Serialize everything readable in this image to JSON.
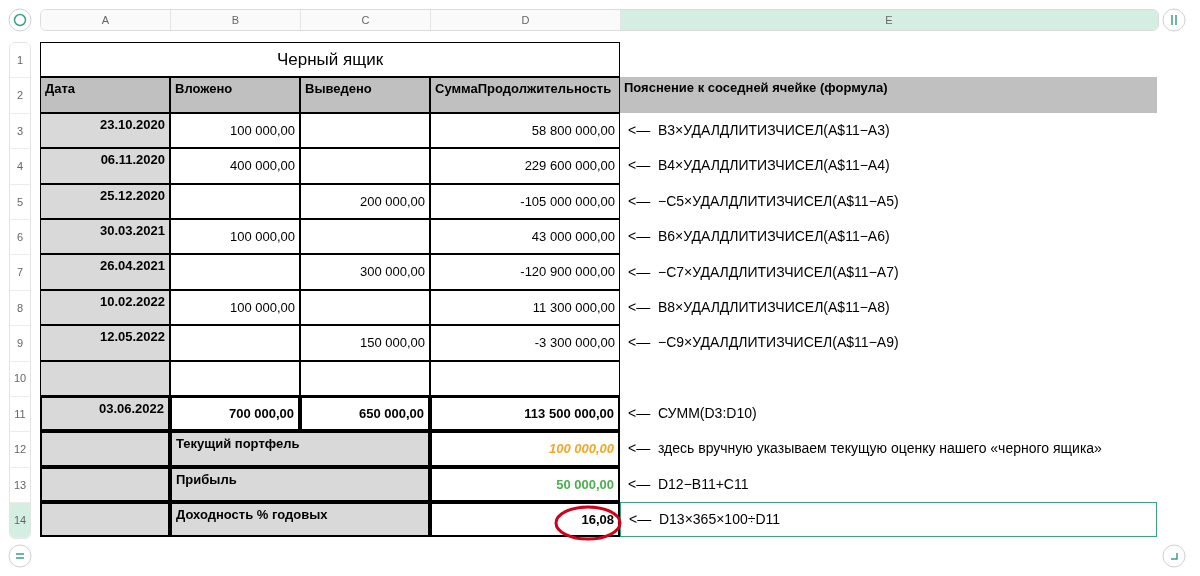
{
  "columns": [
    {
      "label": "A",
      "selected": false
    },
    {
      "label": "B",
      "selected": false
    },
    {
      "label": "C",
      "selected": false
    },
    {
      "label": "D",
      "selected": false
    },
    {
      "label": "E",
      "selected": true
    }
  ],
  "row_numbers": [
    {
      "label": "1",
      "selected": false
    },
    {
      "label": "2",
      "selected": false
    },
    {
      "label": "3",
      "selected": false
    },
    {
      "label": "4",
      "selected": false
    },
    {
      "label": "5",
      "selected": false
    },
    {
      "label": "6",
      "selected": false
    },
    {
      "label": "7",
      "selected": false
    },
    {
      "label": "8",
      "selected": false
    },
    {
      "label": "9",
      "selected": false
    },
    {
      "label": "10",
      "selected": false
    },
    {
      "label": "11",
      "selected": false
    },
    {
      "label": "12",
      "selected": false
    },
    {
      "label": "13",
      "selected": false
    },
    {
      "label": "14",
      "selected": true
    }
  ],
  "title": "Черный ящик",
  "headers": [
    "Дата",
    "Вложено",
    "Выведено",
    "СуммаПродолжительность",
    "Пояснение к соседней ячейке (формула)"
  ],
  "rows": [
    {
      "date": "23.10.2020",
      "invested": "100 000,00",
      "sum": "58 800 000,00",
      "note": "<—  B3×УДАЛДЛИТИЗЧИСЕЛ(A$11−A3)"
    },
    {
      "date": "06.11.2020",
      "invested": "400 000,00",
      "sum": "229 600 000,00",
      "note": "<—  B4×УДАЛДЛИТИЗЧИСЕЛ(A$11−A4)"
    },
    {
      "date": "25.12.2020",
      "withdrawn": "200 000,00",
      "sum": "-105 000 000,00",
      "note": "<—  −C5×УДАЛДЛИТИЗЧИСЕЛ(A$11−A5)"
    },
    {
      "date": "30.03.2021",
      "invested": "100 000,00",
      "sum": "43 000 000,00",
      "note": "<—  B6×УДАЛДЛИТИЗЧИСЕЛ(A$11−A6)"
    },
    {
      "date": "26.04.2021",
      "withdrawn": "300 000,00",
      "sum": "-120 900 000,00",
      "note": "<—  −C7×УДАЛДЛИТИЗЧИСЕЛ(A$11−A7)"
    },
    {
      "date": "10.02.2022",
      "invested": "100 000,00",
      "sum": "11 300 000,00",
      "note": "<—  B8×УДАЛДЛИТИЗЧИСЕЛ(A$11−A8)"
    },
    {
      "date": "12.05.2022",
      "withdrawn": "150 000,00",
      "sum": "-3 300 000,00",
      "note": "<—  −C9×УДАЛДЛИТИЗЧИСЕЛ(A$11−A9)"
    },
    {}
  ],
  "total": {
    "date": "03.06.2022",
    "invested": "700 000,00",
    "withdrawn": "650 000,00",
    "sum": "113 500 000,00",
    "note": "<—  СУММ(D3:D10)"
  },
  "summary": [
    {
      "label": "Текущий портфель",
      "value": "100 000,00",
      "color": "#f5a623",
      "italic": true,
      "circled": false,
      "selected": false,
      "note": "<—  здесь вручную указываем текущую оценку нашего «черного ящика»"
    },
    {
      "label": "Прибыль",
      "value": "50 000,00",
      "color": "#4caf50",
      "italic": false,
      "circled": false,
      "selected": false,
      "note": "<—  D12−B11+C11"
    },
    {
      "label": "Доходность % годовых",
      "value": "16,08",
      "color": "#000000",
      "italic": false,
      "circled": true,
      "selected": true,
      "note": "<—  D13×365×100÷D11"
    }
  ]
}
